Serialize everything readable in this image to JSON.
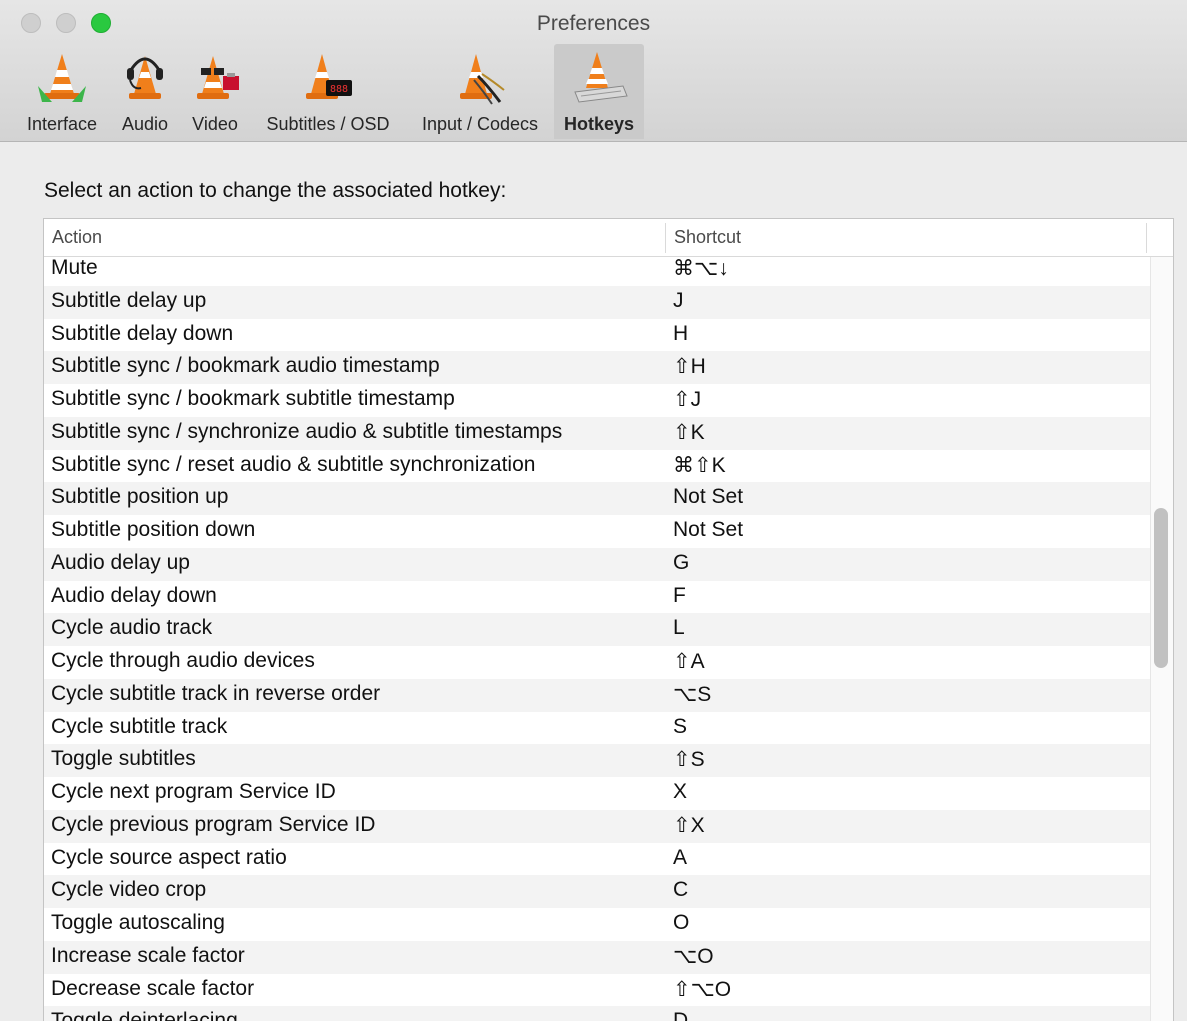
{
  "window": {
    "title": "Preferences"
  },
  "tabs": [
    {
      "label": "Interface",
      "icon": "interface-cone-icon"
    },
    {
      "label": "Audio",
      "icon": "audio-cone-headphones-icon"
    },
    {
      "label": "Video",
      "icon": "video-cone-glasses-icon"
    },
    {
      "label": "Subtitles / OSD",
      "icon": "subtitles-cone-display-icon"
    },
    {
      "label": "Input / Codecs",
      "icon": "input-cone-cables-icon"
    },
    {
      "label": "Hotkeys",
      "icon": "hotkeys-cone-keyboard-icon",
      "selected": true
    }
  ],
  "hotkeys": {
    "prompt": "Select an action to change the associated hotkey:",
    "columns": {
      "action": "Action",
      "shortcut": "Shortcut"
    },
    "rows": [
      {
        "action": "Mute",
        "shortcut": "⌘⌥↓"
      },
      {
        "action": "Subtitle delay up",
        "shortcut": "J"
      },
      {
        "action": "Subtitle delay down",
        "shortcut": "H"
      },
      {
        "action": "Subtitle sync / bookmark audio timestamp",
        "shortcut": "⇧H"
      },
      {
        "action": "Subtitle sync / bookmark subtitle timestamp",
        "shortcut": "⇧J"
      },
      {
        "action": "Subtitle sync / synchronize audio & subtitle timestamps",
        "shortcut": "⇧K"
      },
      {
        "action": "Subtitle sync / reset audio & subtitle synchronization",
        "shortcut": "⌘⇧K"
      },
      {
        "action": "Subtitle position up",
        "shortcut": "Not Set"
      },
      {
        "action": "Subtitle position down",
        "shortcut": "Not Set"
      },
      {
        "action": "Audio delay up",
        "shortcut": "G"
      },
      {
        "action": "Audio delay down",
        "shortcut": "F"
      },
      {
        "action": "Cycle audio track",
        "shortcut": "L"
      },
      {
        "action": "Cycle through audio devices",
        "shortcut": "⇧A"
      },
      {
        "action": "Cycle subtitle track in reverse order",
        "shortcut": "⌥S"
      },
      {
        "action": "Cycle subtitle track",
        "shortcut": "S"
      },
      {
        "action": "Toggle subtitles",
        "shortcut": "⇧S"
      },
      {
        "action": "Cycle next program Service ID",
        "shortcut": "X"
      },
      {
        "action": "Cycle previous program Service ID",
        "shortcut": "⇧X"
      },
      {
        "action": "Cycle source aspect ratio",
        "shortcut": "A"
      },
      {
        "action": "Cycle video crop",
        "shortcut": "C"
      },
      {
        "action": "Toggle autoscaling",
        "shortcut": "O"
      },
      {
        "action": "Increase scale factor",
        "shortcut": "⌥O"
      },
      {
        "action": "Decrease scale factor",
        "shortcut": "⇧⌥O"
      },
      {
        "action": "Toggle deinterlacing",
        "shortcut": "D"
      }
    ]
  },
  "colors": {
    "zoom_button": "#2ac940",
    "cone_orange": "#f07f1b"
  }
}
